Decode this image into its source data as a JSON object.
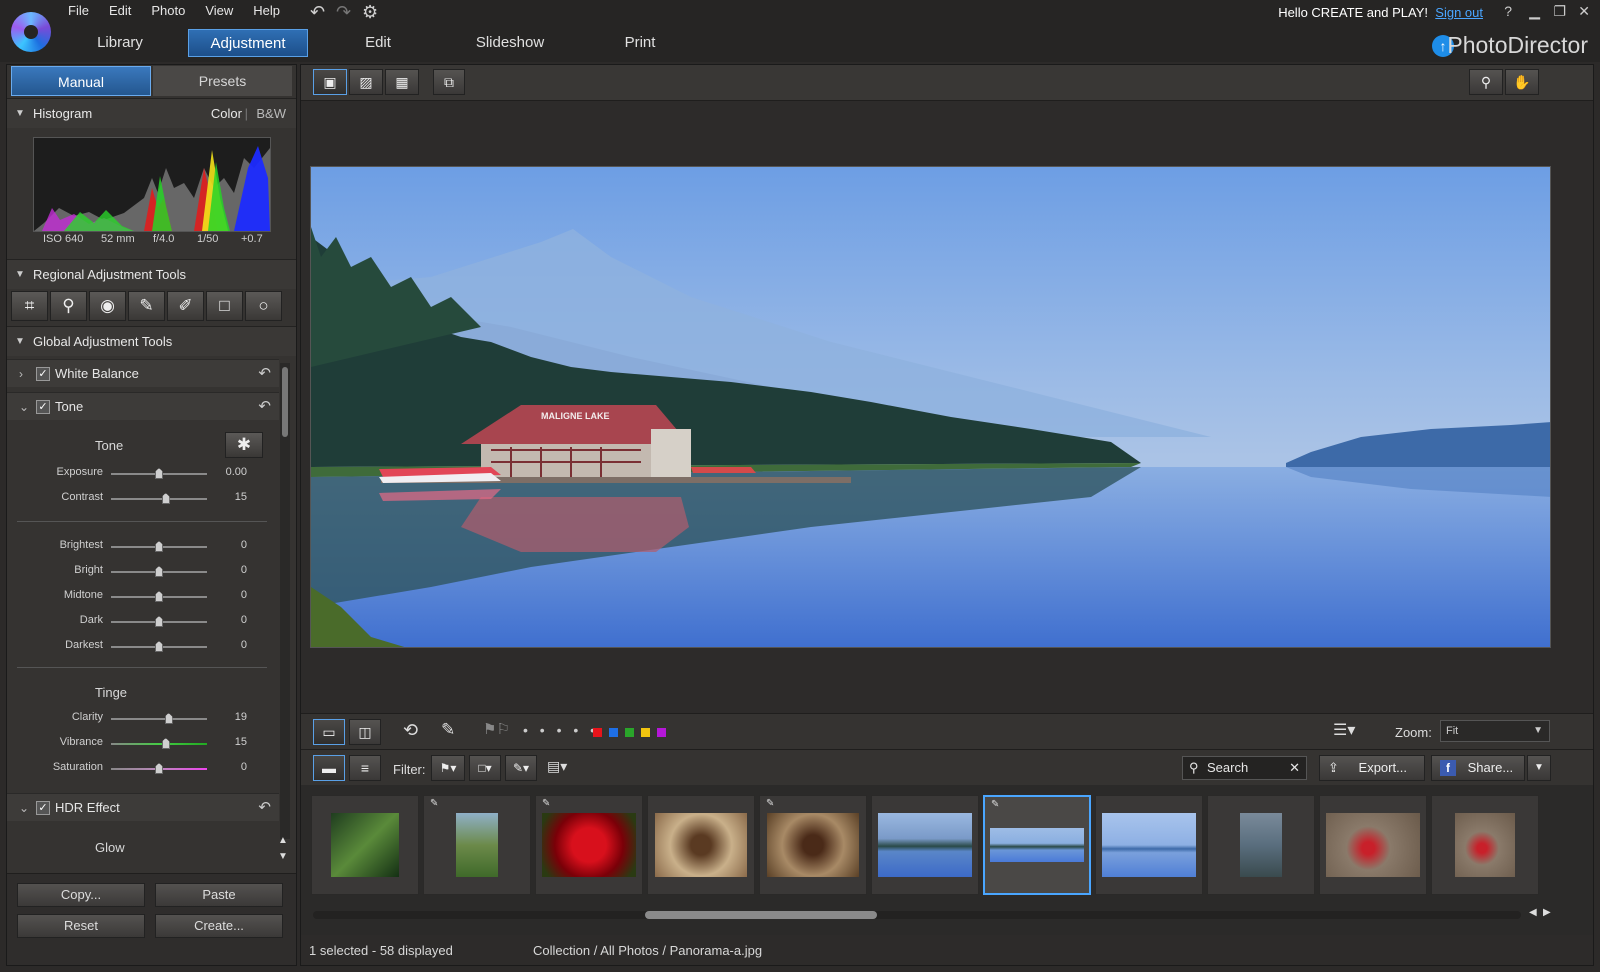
{
  "menu": [
    "File",
    "Edit",
    "Photo",
    "View",
    "Help"
  ],
  "toolbar_icons": [
    "undo-icon",
    "redo-icon",
    "settings-icon"
  ],
  "modes": [
    "Library",
    "Adjustment",
    "Edit",
    "Slideshow",
    "Print"
  ],
  "active_mode": "Adjustment",
  "account": {
    "greeting": "Hello CREATE and PLAY!",
    "signout": "Sign out",
    "help": "?"
  },
  "brand": "PhotoDirector",
  "left_panel": {
    "tabs": {
      "manual": "Manual",
      "presets": "Presets"
    },
    "histogram": {
      "title": "Histogram",
      "color": "Color",
      "bw": "B&W",
      "exif": {
        "iso": "ISO 640",
        "focal": "52 mm",
        "aperture": "f/4.0",
        "shutter": "1/50",
        "ev": "+0.7"
      }
    },
    "regional_title": "Regional Adjustment Tools",
    "global_title": "Global Adjustment Tools",
    "white_balance": "White Balance",
    "tone": "Tone",
    "tone_sub": "Tone",
    "tone_sliders": [
      {
        "label": "Exposure",
        "value": "0.00",
        "pos": 0.5
      },
      {
        "label": "Contrast",
        "value": "15",
        "pos": 0.57
      }
    ],
    "level_sliders": [
      {
        "label": "Brightest",
        "value": "0",
        "pos": 0.5
      },
      {
        "label": "Bright",
        "value": "0",
        "pos": 0.5
      },
      {
        "label": "Midtone",
        "value": "0",
        "pos": 0.5
      },
      {
        "label": "Dark",
        "value": "0",
        "pos": 0.5
      },
      {
        "label": "Darkest",
        "value": "0",
        "pos": 0.5
      }
    ],
    "tinge_sub": "Tinge",
    "tinge_sliders": [
      {
        "label": "Clarity",
        "value": "19",
        "pos": 0.6
      },
      {
        "label": "Vibrance",
        "value": "15",
        "pos": 0.57
      },
      {
        "label": "Saturation",
        "value": "0",
        "pos": 0.5
      }
    ],
    "hdr": "HDR Effect",
    "glow": "Glow",
    "buttons": {
      "copy": "Copy...",
      "paste": "Paste",
      "reset": "Reset",
      "create": "Create..."
    }
  },
  "viewer": {
    "filter_label": "Filter:",
    "zoom_label": "Zoom:",
    "zoom_value": "Fit",
    "search": "Search",
    "export": "Export...",
    "share": "Share...",
    "color_labels": [
      "#e8141b",
      "#1e6fe6",
      "#2aa52a",
      "#f1c40f",
      "#b517d8"
    ],
    "boathouse_sign": "MALIGNE LAKE"
  },
  "status": {
    "selection": "1 selected - 58 displayed",
    "path": "Collection / All Photos / Panorama-a.jpg"
  }
}
